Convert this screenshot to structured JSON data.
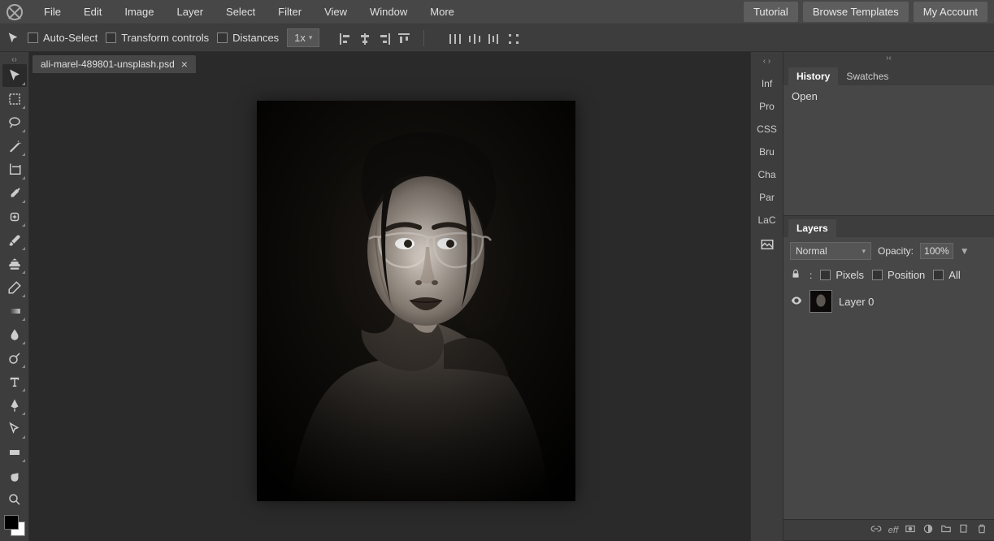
{
  "menubar": {
    "items": [
      "File",
      "Edit",
      "Image",
      "Layer",
      "Select",
      "Filter",
      "View",
      "Window",
      "More"
    ]
  },
  "topbuttons": {
    "tutorial": "Tutorial",
    "browse": "Browse Templates",
    "account": "My Account"
  },
  "options": {
    "auto_select": "Auto-Select",
    "transform": "Transform controls",
    "distances": "Distances",
    "zoom": "1x"
  },
  "tab": {
    "filename": "ali-marel-489801-unsplash.psd"
  },
  "side_panels": {
    "items": [
      "Inf",
      "Pro",
      "CSS",
      "Bru",
      "Cha",
      "Par",
      "LaC"
    ]
  },
  "history_panel": {
    "tabs": [
      "History",
      "Swatches"
    ],
    "active": 0,
    "entries": [
      "Open"
    ]
  },
  "layers_panel": {
    "title": "Layers",
    "blend_mode": "Normal",
    "opacity_label": "Opacity:",
    "opacity_value": "100%",
    "lock": {
      "pixels": "Pixels",
      "position": "Position",
      "all": "All"
    },
    "layers": [
      {
        "name": "Layer 0"
      }
    ]
  }
}
